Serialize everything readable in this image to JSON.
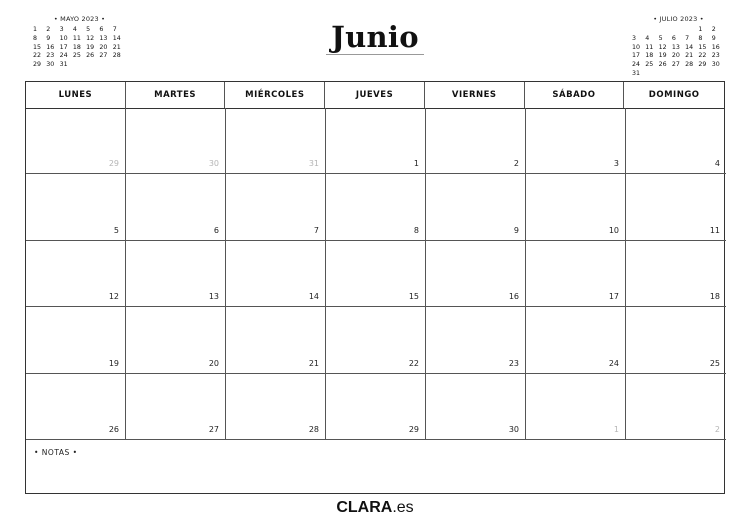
{
  "title": "Junio",
  "mini_prev": {
    "title": "• MAYO 2023 •",
    "days": [
      "1",
      "2",
      "3",
      "4",
      "5",
      "6",
      "7",
      "8",
      "9",
      "10",
      "11",
      "12",
      "13",
      "14",
      "15",
      "16",
      "17",
      "18",
      "19",
      "20",
      "21",
      "22",
      "23",
      "24",
      "25",
      "26",
      "27",
      "28",
      "29",
      "30",
      "31"
    ]
  },
  "mini_next": {
    "title": "• JULIO 2023 •",
    "days": [
      "",
      "",
      "",
      "",
      "",
      "1",
      "2",
      "3",
      "4",
      "5",
      "6",
      "7",
      "8",
      "9",
      "10",
      "11",
      "12",
      "13",
      "14",
      "15",
      "16",
      "17",
      "18",
      "19",
      "20",
      "21",
      "22",
      "23",
      "24",
      "25",
      "26",
      "27",
      "28",
      "29",
      "30",
      "31"
    ]
  },
  "weekdays": [
    "LUNES",
    "MARTES",
    "MIÉRCOLES",
    "JUEVES",
    "VIERNES",
    "SÁBADO",
    "DOMINGO"
  ],
  "cells": [
    {
      "day": "29",
      "dim": true
    },
    {
      "day": "30",
      "dim": true
    },
    {
      "day": "31",
      "dim": true
    },
    {
      "day": "1",
      "dim": false
    },
    {
      "day": "2",
      "dim": false
    },
    {
      "day": "3",
      "dim": false
    },
    {
      "day": "4",
      "dim": false
    },
    {
      "day": "5",
      "dim": false
    },
    {
      "day": "6",
      "dim": false
    },
    {
      "day": "7",
      "dim": false
    },
    {
      "day": "8",
      "dim": false
    },
    {
      "day": "9",
      "dim": false
    },
    {
      "day": "10",
      "dim": false
    },
    {
      "day": "11",
      "dim": false
    },
    {
      "day": "12",
      "dim": false
    },
    {
      "day": "13",
      "dim": false
    },
    {
      "day": "14",
      "dim": false
    },
    {
      "day": "15",
      "dim": false
    },
    {
      "day": "16",
      "dim": false
    },
    {
      "day": "17",
      "dim": false
    },
    {
      "day": "18",
      "dim": false
    },
    {
      "day": "19",
      "dim": false
    },
    {
      "day": "20",
      "dim": false
    },
    {
      "day": "21",
      "dim": false
    },
    {
      "day": "22",
      "dim": false
    },
    {
      "day": "23",
      "dim": false
    },
    {
      "day": "24",
      "dim": false
    },
    {
      "day": "25",
      "dim": false
    },
    {
      "day": "26",
      "dim": false
    },
    {
      "day": "27",
      "dim": false
    },
    {
      "day": "28",
      "dim": false
    },
    {
      "day": "29",
      "dim": false
    },
    {
      "day": "30",
      "dim": false
    },
    {
      "day": "1",
      "dim": true
    },
    {
      "day": "2",
      "dim": true
    }
  ],
  "notes_label": "• NOTAS •",
  "brand": {
    "bold": "CLARA",
    "rest": ".es"
  }
}
